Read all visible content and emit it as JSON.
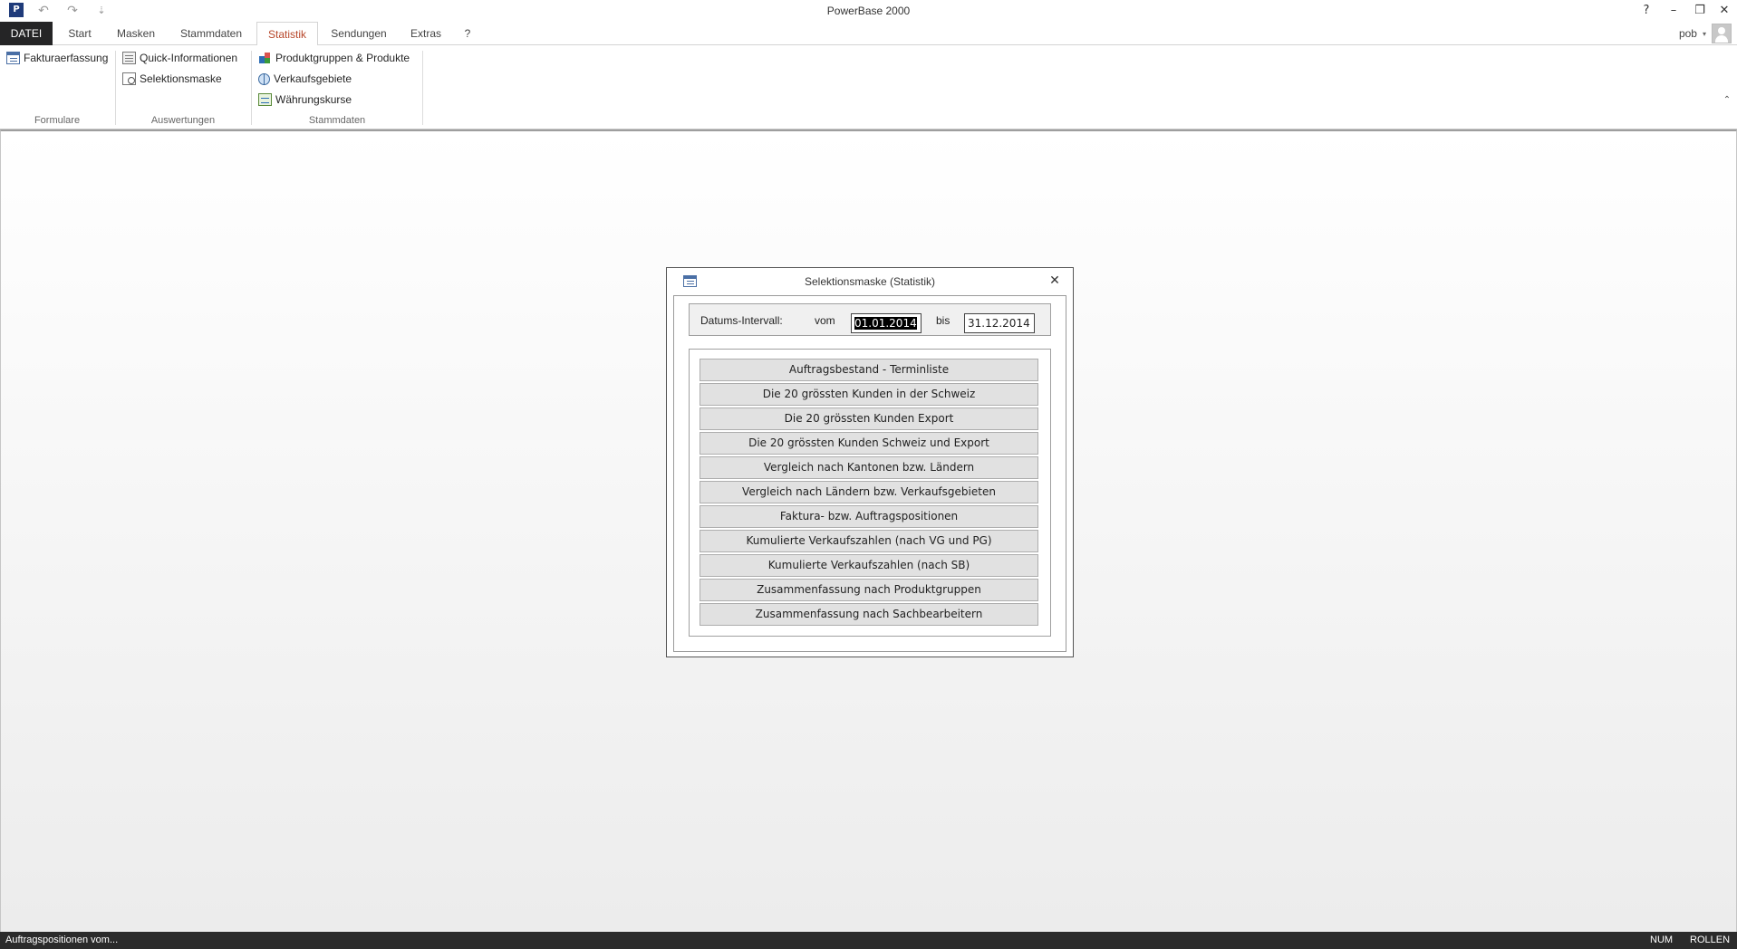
{
  "window": {
    "title": "PowerBase 2000",
    "app_icon_text": "P",
    "help_symbol": "?",
    "minimize_symbol": "–",
    "restore_symbol": "❐",
    "close_symbol": "✕"
  },
  "quick_access": {
    "undo_symbol": "↶",
    "redo_symbol": "↷",
    "customize_symbol": "⇣"
  },
  "ribbon_tabs": [
    {
      "label": "DATEI"
    },
    {
      "label": "Start"
    },
    {
      "label": "Masken"
    },
    {
      "label": "Stammdaten"
    },
    {
      "label": "Statistik"
    },
    {
      "label": "Sendungen"
    },
    {
      "label": "Extras"
    },
    {
      "label": "?"
    }
  ],
  "active_tab": "Statistik",
  "user": {
    "name": "pob",
    "caret": "▾"
  },
  "ribbon_groups": {
    "formulare": {
      "label": "Formulare",
      "items": [
        {
          "label": "Fakturaerfassung",
          "icon": "form-icon"
        }
      ]
    },
    "auswertungen": {
      "label": "Auswertungen",
      "items": [
        {
          "label": "Quick-Informationen",
          "icon": "quick-info-icon"
        },
        {
          "label": "Selektionsmaske",
          "icon": "selection-mask-icon"
        }
      ]
    },
    "stammdaten": {
      "label": "Stammdaten",
      "items": [
        {
          "label": "Produktgruppen & Produkte",
          "icon": "product-groups-icon"
        },
        {
          "label": "Verkaufsgebiete",
          "icon": "globe-icon"
        },
        {
          "label": "Währungskurse",
          "icon": "currency-icon"
        }
      ]
    }
  },
  "collapse_symbol": "⌃",
  "dialog": {
    "title": "Selektionsmaske (Statistik)",
    "close_symbol": "✕",
    "date_interval": {
      "label": "Datums-Intervall:",
      "from_label": "vom",
      "from_value": "01.01.2014",
      "to_label": "bis",
      "to_value": "31.12.2014"
    },
    "report_buttons": [
      {
        "label": "Auftragsbestand - Terminliste"
      },
      {
        "label": "Die 20 grössten Kunden in der Schweiz"
      },
      {
        "label": "Die 20 grössten Kunden Export"
      },
      {
        "label": "Die 20 grössten Kunden Schweiz und Export"
      },
      {
        "label": "Vergleich nach Kantonen bzw. Ländern"
      },
      {
        "label": "Vergleich nach Ländern bzw. Verkaufsgebieten"
      },
      {
        "label": "Faktura- bzw. Auftragspositionen"
      },
      {
        "label": "Kumulierte Verkaufszahlen (nach VG und PG)"
      },
      {
        "label": "Kumulierte Verkaufszahlen (nach SB)"
      },
      {
        "label": "Zusammenfassung nach Produktgruppen"
      },
      {
        "label": "Zusammenfassung nach Sachbearbeitern"
      }
    ]
  },
  "statusbar": {
    "text": "Auftragspositionen vom...",
    "num": "NUM",
    "rollen": "ROLLEN"
  },
  "colors": {
    "active_tab_text": "#b7472a",
    "file_tab_bg": "#252526",
    "statusbar_bg": "#2b2b2b"
  }
}
